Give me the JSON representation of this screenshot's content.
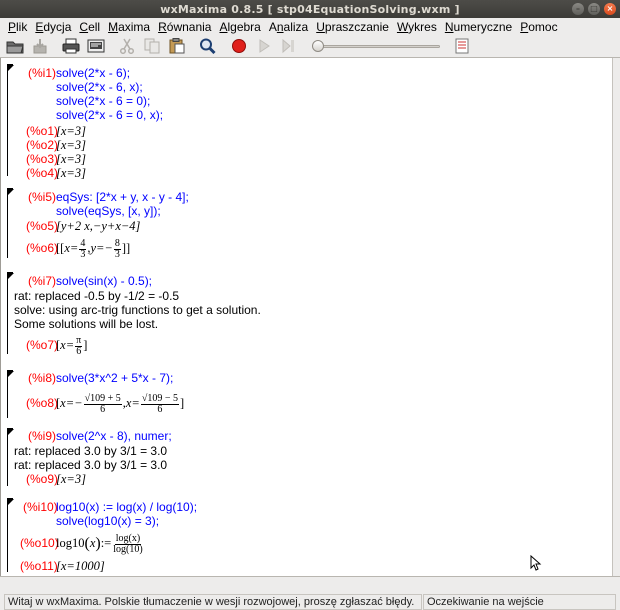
{
  "window": {
    "title": "wxMaxima 0.8.5  [ stp04EquationSolving.wxm ]"
  },
  "menu": [
    {
      "pre": "",
      "u": "P",
      "post": "lik"
    },
    {
      "pre": "",
      "u": "E",
      "post": "dycja"
    },
    {
      "pre": "",
      "u": "C",
      "post": "ell"
    },
    {
      "pre": "",
      "u": "M",
      "post": "axima"
    },
    {
      "pre": "",
      "u": "R",
      "post": "ównania"
    },
    {
      "pre": "",
      "u": "A",
      "post": "lgebra"
    },
    {
      "pre": "A",
      "u": "n",
      "post": "aliza"
    },
    {
      "pre": "",
      "u": "U",
      "post": "praszczanie"
    },
    {
      "pre": "",
      "u": "W",
      "post": "ykres"
    },
    {
      "pre": "",
      "u": "N",
      "post": "umeryczne"
    },
    {
      "pre": "",
      "u": "P",
      "post": "omoc"
    }
  ],
  "toolbar_icons": [
    "open-icon",
    "save-icon",
    "print-icon",
    "config-icon",
    "cut-icon",
    "copy-icon",
    "paste-icon",
    "find-icon",
    "stop-icon",
    "play-icon",
    "step-icon",
    "animation-slider",
    "info-icon"
  ],
  "cells": {
    "c1": {
      "in_label": "(%i1)",
      "in_lines": [
        "solve(2*x - 6);",
        "solve(2*x - 6, x);",
        "solve(2*x - 6 = 0);",
        "solve(2*x - 6 = 0, x);"
      ],
      "outputs": [
        {
          "label": "(%o1)",
          "value": "[x=3]"
        },
        {
          "label": "(%o2)",
          "value": "[x=3]"
        },
        {
          "label": "(%o3)",
          "value": "[x=3]"
        },
        {
          "label": "(%o4)",
          "value": "[x=3]"
        }
      ]
    },
    "c2": {
      "in_label": "(%i5)",
      "in_lines": [
        "eqSys: [2*x + y, x - y - 4];",
        "solve(eqSys, [x, y]);"
      ],
      "o5_label": "(%o5)",
      "o5_value": "[y+2 x,−y+x−4]",
      "o6_label": "(%o6)",
      "o6_parts": {
        "open": "[[",
        "x_eq": "x=",
        "xnum": "4",
        "xden": "3",
        "comma": ",",
        "y_eq": "y=−",
        "ynum": "8",
        "yden": "3",
        "close": "]]"
      }
    },
    "c3": {
      "in_label": "(%i7)",
      "in_line": "solve(sin(x) - 0.5);",
      "messages": [
        "rat: replaced -0.5 by -1/2 = -0.5",
        "solve: using arc-trig functions to get a solution.",
        "Some solutions will be lost."
      ],
      "o7_label": "(%o7)",
      "o7_parts": {
        "open": "[",
        "x_eq": "x=",
        "num": "π",
        "den": "6",
        "close": "]"
      }
    },
    "c4": {
      "in_label": "(%i8)",
      "in_line": "solve(3*x^2 + 5*x - 7);",
      "o8_label": "(%o8)",
      "o8_parts": {
        "open": "[",
        "x1": "x=−",
        "n1": "√109 + 5",
        "d1": "6",
        "sep": ",",
        "x2": "x=",
        "n2": "√109 − 5",
        "d2": "6",
        "close": "]"
      }
    },
    "c5": {
      "in_label": "(%i9)",
      "in_line": "solve(2^x - 8), numer;",
      "messages": [
        "rat: replaced 3.0 by 3/1 = 3.0",
        "rat: replaced 3.0 by 3/1 = 3.0"
      ],
      "o9_label": "(%o9)",
      "o9_value": "[x=3]"
    },
    "c6": {
      "in_label": "(%i10)",
      "in_lines": [
        "log10(x) := log(x) / log(10);",
        "solve(log10(x) = 3);"
      ],
      "o10_label": "(%o10)",
      "o10_parts": {
        "lhs": "log10",
        "arg": "x",
        "def": ":=",
        "num": "log(x)",
        "den": "log(10)"
      },
      "o11_label": "(%o11)",
      "o11_value": "[x=1000]"
    }
  },
  "status": {
    "left": "Witaj w wxMaxima. Polskie tłumaczenie w wesji rozwojowej, proszę zgłaszać błędy.",
    "right": "Oczekiwanie na wejście"
  }
}
